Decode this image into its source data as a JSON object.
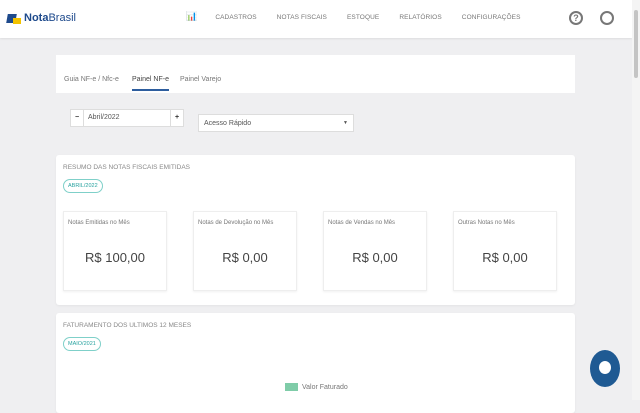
{
  "header": {
    "brand": {
      "bold": "Nota",
      "rest": "Brasil"
    },
    "nav": [
      "CADASTROS",
      "NOTAS FISCAIS",
      "ESTOQUE",
      "RELATÓRIOS",
      "CONFIGURAÇÕES"
    ],
    "help_icon": "?"
  },
  "tabs": [
    "Guia NF-e / Nfc-e",
    "Painel NF-e",
    "Painel Varejo"
  ],
  "filters": {
    "minus": "−",
    "month": "Abril/2022",
    "plus": "+",
    "quick_access": "Acesso Rápido",
    "caret": "▼"
  },
  "summary": {
    "title": "RESUMO DAS NOTAS FISCAIS EMITIDAS",
    "period": "ABRIL/2022",
    "cards": [
      {
        "label": "Notas Emitidas no Mês",
        "value": "R$ 100,00"
      },
      {
        "label": "Notas de Devolução no Mês",
        "value": "R$ 0,00"
      },
      {
        "label": "Notas de Vendas no Mês",
        "value": "R$ 0,00"
      },
      {
        "label": "Outras Notas no Mês",
        "value": "R$ 0,00"
      }
    ]
  },
  "billing": {
    "title": "FATURAMENTO DOS ULTIMOS 12 MESES",
    "period": "MAIO/2021",
    "legend": "Valor Faturado"
  },
  "colors": {
    "brand": "#1e4a8c",
    "accent": "#2aa3a0",
    "legend": "#7fcca8",
    "chat": "#1f5a93"
  }
}
